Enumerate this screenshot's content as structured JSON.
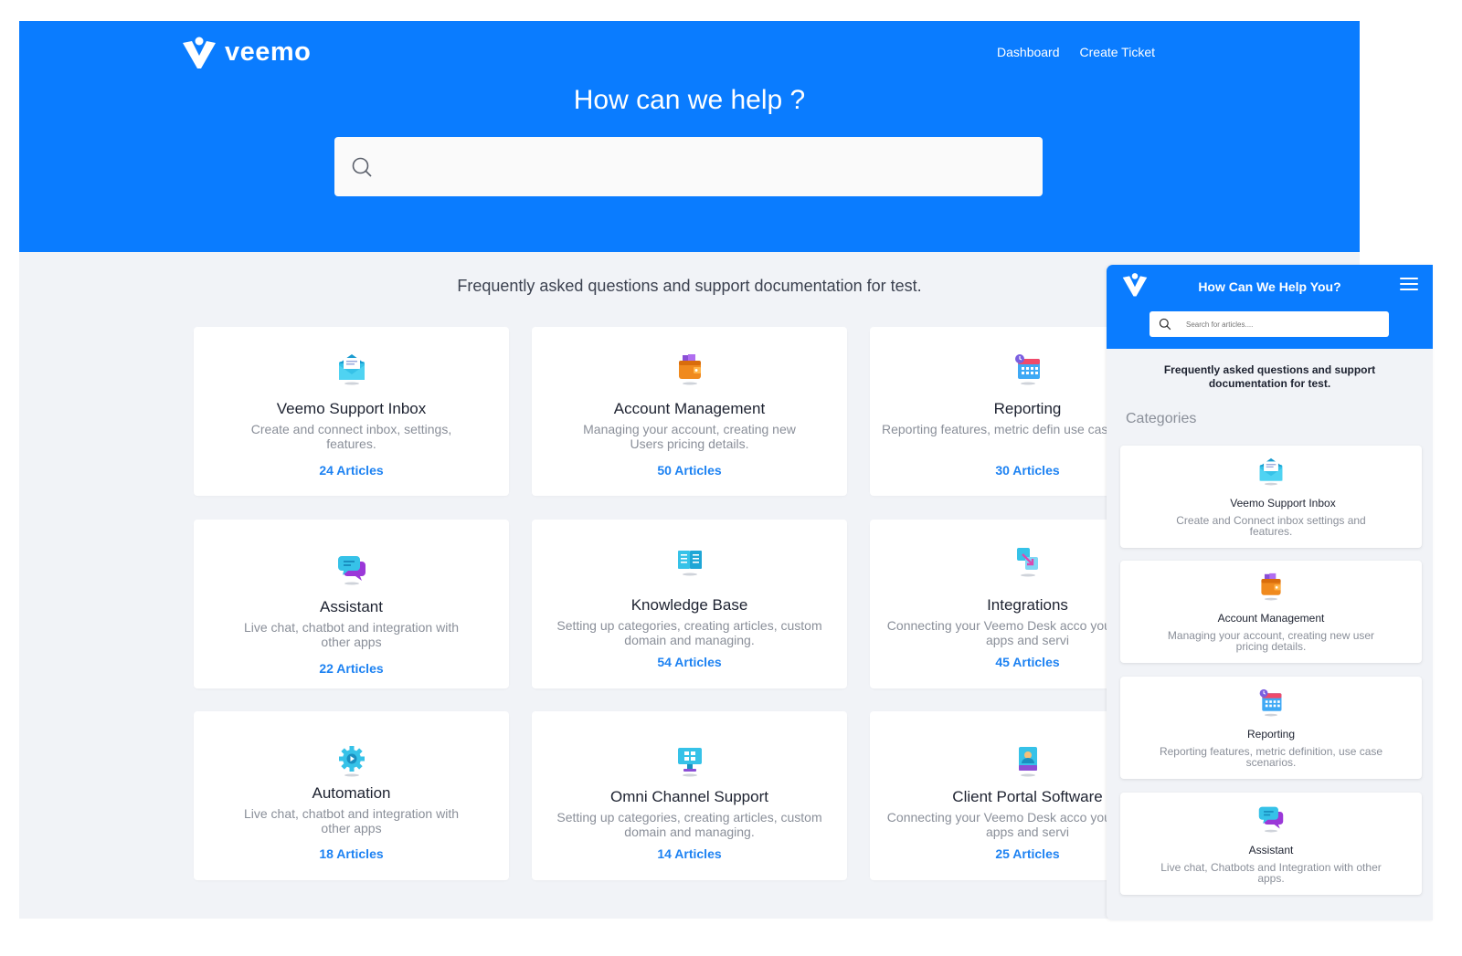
{
  "brand": {
    "name": "veemo",
    "color": "#0a7cff"
  },
  "nav": {
    "dashboard": "Dashboard",
    "create_ticket": "Create Ticket"
  },
  "hero": {
    "title": "How can we help ?",
    "search_placeholder": ""
  },
  "subtitle": "Frequently asked questions and support documentation for test.",
  "categories": [
    {
      "icon": "inbox-icon",
      "title": "Veemo Support Inbox",
      "description": "Create and connect inbox, settings, features.",
      "count": "24 Articles"
    },
    {
      "icon": "wallet-icon",
      "title": "Account Management",
      "description": "Managing your account, creating new Users pricing details.",
      "count": "50 Articles"
    },
    {
      "icon": "calendar-icon",
      "title": "Reporting",
      "description": "Reporting features, metric defin use case scenarios",
      "count": "30 Articles"
    },
    {
      "icon": "chat-bubbles-icon",
      "title": "Assistant",
      "description": "Live chat, chatbot and integration with other apps",
      "count": "22 Articles"
    },
    {
      "icon": "book-icon",
      "title": "Knowledge Base",
      "description": "Setting up categories, creating articles, custom domain and managing.",
      "count": "54 Articles"
    },
    {
      "icon": "integration-icon",
      "title": "Integrations",
      "description": "Connecting your Veemo Desk acco your favourite apps and servi",
      "count": "45 Articles"
    },
    {
      "icon": "gear-icon",
      "title": "Automation",
      "description": "Live chat, chatbot and integration with other apps",
      "count": "18 Articles"
    },
    {
      "icon": "monitor-icon",
      "title": "Omni Channel Support",
      "description": "Setting up categories, creating articles, custom domain and managing.",
      "count": "14 Articles"
    },
    {
      "icon": "portal-icon",
      "title": "Client Portal Software",
      "description": "Connecting your Veemo Desk acco your favourite apps and servi",
      "count": "25 Articles"
    }
  ],
  "mobile": {
    "title": "How Can We Help You?",
    "search_placeholder": "Search for articles....",
    "subtitle": "Frequently asked questions and support documentation for test.",
    "categories_heading": "Categories",
    "categories": [
      {
        "icon": "inbox-icon",
        "title": "Veemo Support Inbox",
        "description": "Create and Connect inbox settings and features."
      },
      {
        "icon": "wallet-icon",
        "title": "Account Management",
        "description": "Managing your account, creating new user pricing details."
      },
      {
        "icon": "calendar-icon",
        "title": "Reporting",
        "description": "Reporting features, metric definition, use case scenarios."
      },
      {
        "icon": "chat-bubbles-icon",
        "title": "Assistant",
        "description": "Live chat, Chatbots and Integration with other apps."
      }
    ]
  }
}
